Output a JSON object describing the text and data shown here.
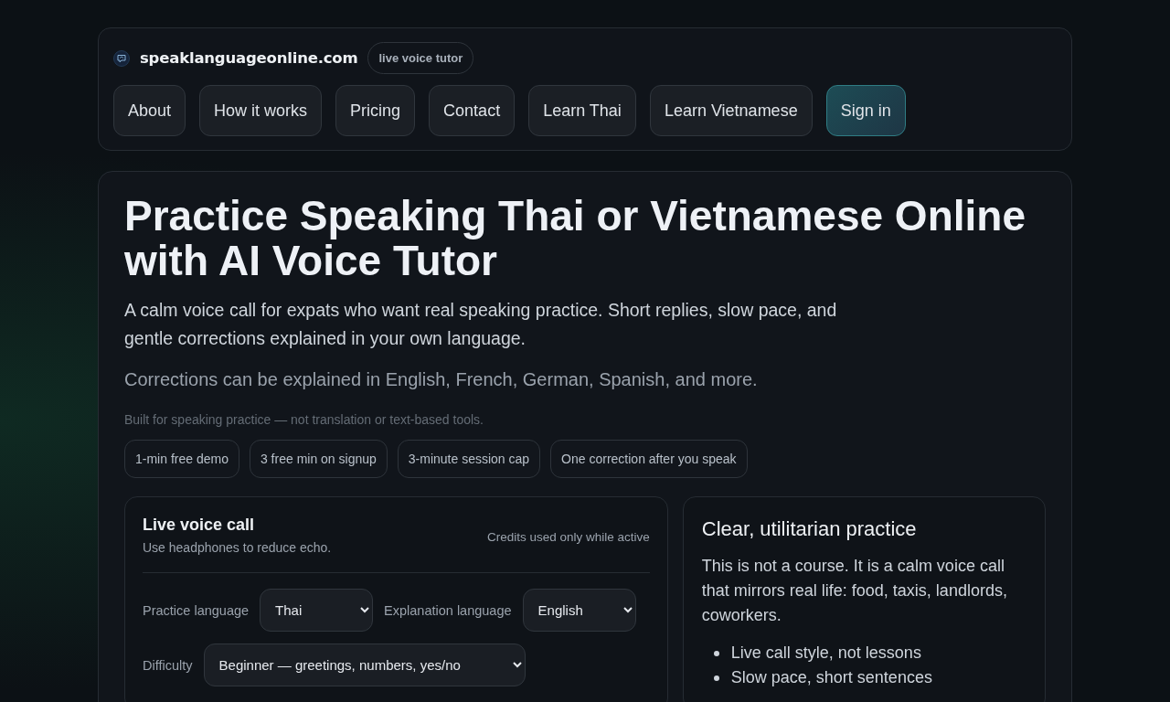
{
  "brand": {
    "name": "speaklanguageonline.com",
    "badge": "live voice tutor"
  },
  "nav": [
    {
      "label": "About",
      "kind": "link"
    },
    {
      "label": "How it works",
      "kind": "link"
    },
    {
      "label": "Pricing",
      "kind": "link"
    },
    {
      "label": "Contact",
      "kind": "link"
    },
    {
      "label": "Learn Thai",
      "kind": "link"
    },
    {
      "label": "Learn Vietnamese",
      "kind": "link"
    },
    {
      "label": "Sign in",
      "kind": "primary"
    }
  ],
  "hero": {
    "title": "Practice Speaking Thai or Vietnamese Online with AI Voice Tutor",
    "lead": "A calm voice call for expats who want real speaking practice. Short replies, slow pace, and gentle corrections explained in your own language.",
    "note": "Corrections can be explained in English, French, German, Spanish, and more.",
    "fine_print": "Built for speaking practice — not translation or text-based tools.",
    "chips": [
      "1-min free demo",
      "3 free min on signup",
      "3-minute session cap",
      "One correction after you speak"
    ]
  },
  "call_card": {
    "title": "Live voice call",
    "subtitle": "Use headphones to reduce echo.",
    "meta": "Credits used only while active",
    "field_rows": [
      [
        {
          "label": "Practice language",
          "value": "Thai"
        },
        {
          "label": "Explanation language",
          "value": "English"
        }
      ],
      [
        {
          "label": "Difficulty",
          "value": "Beginner — greetings, numbers, yes/no"
        }
      ]
    ]
  },
  "info_card": {
    "title": "Clear, utilitarian practice",
    "text": "This is not a course. It is a calm voice call that mirrors real life: food, taxis, landlords, coworkers.",
    "bullets": [
      "Live call style, not lessons",
      "Slow pace, short sentences"
    ]
  }
}
